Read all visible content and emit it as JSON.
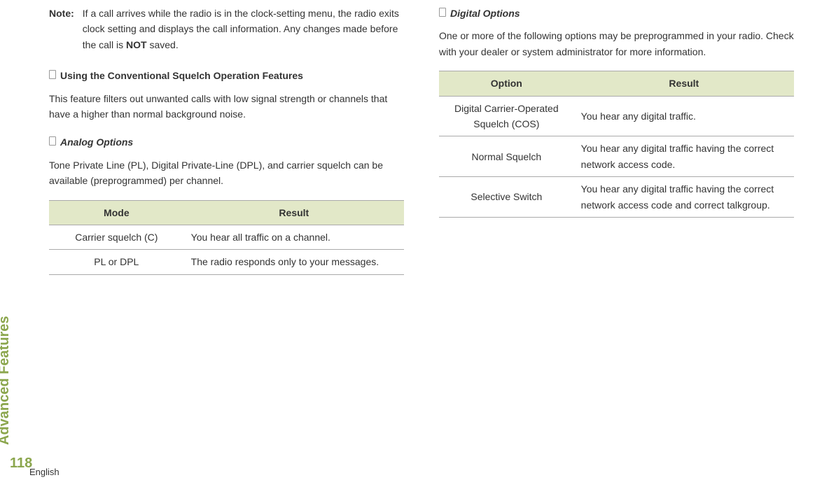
{
  "sidebar": {
    "label": "Advanced Features",
    "page_number": "118",
    "language": "English"
  },
  "left": {
    "note": {
      "label": "Note:",
      "text_parts": {
        "before": "If a call arrives while the radio is in the clock-setting menu, the radio exits clock setting and displays the call information. Any changes made before the call is ",
        "bold": "NOT",
        "after": " saved."
      }
    },
    "h1": "Using the Conventional Squelch Operation Features",
    "p1": "This feature filters out unwanted calls with low signal strength or channels that have a higher than normal background noise.",
    "h2": "Analog Options",
    "p2": "Tone Private Line (PL), Digital Private-Line (DPL), and carrier squelch can be available (preprogrammed) per channel.",
    "table": {
      "headers": {
        "mode": "Mode",
        "result": "Result"
      },
      "rows": [
        {
          "mode": "Carrier squelch (C)",
          "result": "You hear all traffic on a channel."
        },
        {
          "mode": "PL or DPL",
          "result": "The radio responds only to your messages."
        }
      ]
    }
  },
  "right": {
    "h1": "Digital Options",
    "p1": "One or more of the following options may be preprogrammed in your radio. Check with your dealer or system administrator for more information.",
    "table": {
      "headers": {
        "option": "Option",
        "result": "Result"
      },
      "rows": [
        {
          "option": "Digital Carrier-Operated Squelch (COS)",
          "result": "You hear any digital traffic."
        },
        {
          "option": "Normal Squelch",
          "result": "You hear any digital traffic having the correct network access code."
        },
        {
          "option": "Selective Switch",
          "result": "You hear any digital traffic having the correct network access code and correct talkgroup."
        }
      ]
    }
  }
}
